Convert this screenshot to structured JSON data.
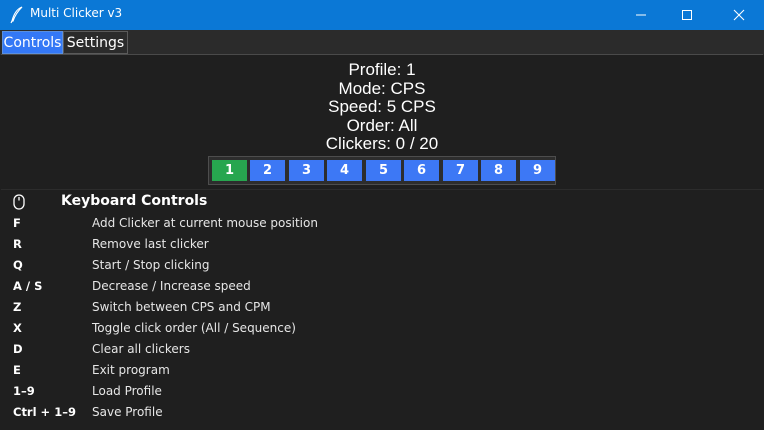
{
  "window": {
    "title": "Multi Clicker v3",
    "icon": "feather-icon",
    "controls": [
      "minimize-icon",
      "maximize-icon",
      "close-icon"
    ]
  },
  "tabs": [
    {
      "label": "Controls",
      "selected": true
    },
    {
      "label": "Settings",
      "selected": false
    }
  ],
  "status": {
    "profile": "Profile: 1",
    "mode": "Mode: CPS",
    "speed": "Speed: 5 CPS",
    "order": "Order: All",
    "clickers": "Clickers: 0 / 20"
  },
  "profiles": {
    "active": 1,
    "active_color": "#27a64f",
    "inactive_color": "#3d78f5",
    "buttons": [
      "1",
      "2",
      "3",
      "4",
      "5",
      "6",
      "7",
      "8",
      "9"
    ]
  },
  "keyboard": {
    "icon": "mouse-icon",
    "title": "Keyboard Controls",
    "rows": [
      {
        "key": "F",
        "desc": "Add Clicker at current mouse position"
      },
      {
        "key": "R",
        "desc": "Remove last clicker"
      },
      {
        "key": "Q",
        "desc": "Start / Stop clicking"
      },
      {
        "key": "A / S",
        "desc": "Decrease / Increase speed"
      },
      {
        "key": "Z",
        "desc": "Switch between CPS and CPM"
      },
      {
        "key": "X",
        "desc": "Toggle click order (All / Sequence)"
      },
      {
        "key": "D",
        "desc": "Clear all clickers"
      },
      {
        "key": "E",
        "desc": "Exit program"
      },
      {
        "key": "1–9",
        "desc": "Load Profile"
      },
      {
        "key": "Ctrl + 1–9",
        "desc": "Save Profile"
      }
    ]
  },
  "colors": {
    "titlebar": "#0b78d6",
    "background": "#1f1f1f",
    "tab_selected": "#3478f6"
  }
}
